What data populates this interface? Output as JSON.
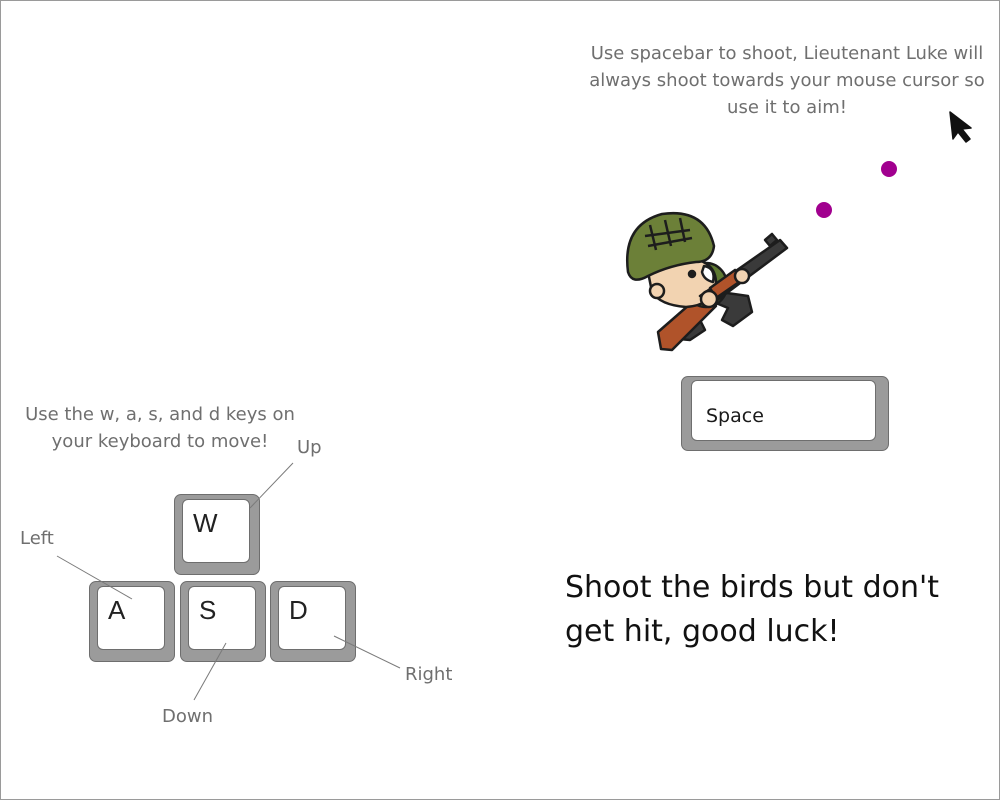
{
  "movement": {
    "instruction": "Use the w, a, s, and d keys on your keyboard to move!",
    "keys": {
      "up": "W",
      "left": "A",
      "down": "S",
      "right": "D"
    },
    "labels": {
      "up": "Up",
      "left": "Left",
      "down": "Down",
      "right": "Right"
    }
  },
  "shooting": {
    "instruction": "Use spacebar to shoot, Lieutenant Luke will always shoot towards your mouse cursor so use it to aim!",
    "key_label": "Space",
    "character_icon": "soldier-with-rifle",
    "cursor_icon": "mouse-pointer-icon",
    "bullet_color": "#a1008f"
  },
  "tagline": "Shoot the birds but don't get hit, good luck!"
}
